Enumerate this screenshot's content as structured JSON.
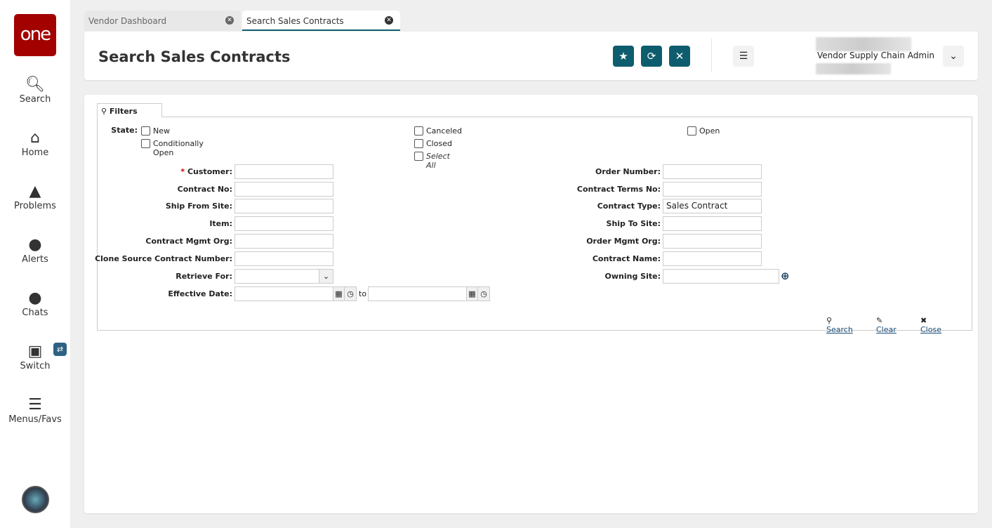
{
  "sidebar": {
    "logo": "one",
    "items": [
      {
        "label": "Search",
        "icon": "search-icon"
      },
      {
        "label": "Home",
        "icon": "home-icon"
      },
      {
        "label": "Problems",
        "icon": "warning-icon"
      },
      {
        "label": "Alerts",
        "icon": "bell-icon"
      },
      {
        "label": "Chats",
        "icon": "chat-icon"
      },
      {
        "label": "Switch",
        "icon": "switch-icon"
      },
      {
        "label": "Menus/Favs",
        "icon": "menu-icon"
      }
    ],
    "switch_badge": "⇄"
  },
  "tabs": [
    {
      "label": "Vendor Dashboard",
      "active": false
    },
    {
      "label": "Search Sales Contracts",
      "active": true
    }
  ],
  "header": {
    "title": "Search Sales Contracts",
    "user_role": "Vendor Supply Chain Admin"
  },
  "filters": {
    "tab_label": "Filters",
    "state_label": "State:",
    "states": [
      {
        "label": "New",
        "checked": false
      },
      {
        "label": "Conditionally Open",
        "checked": false
      },
      {
        "label": "Canceled",
        "checked": false
      },
      {
        "label": "Closed",
        "checked": false
      },
      {
        "label": "Select All",
        "checked": false
      },
      {
        "label": "Open",
        "checked": false
      }
    ],
    "left_fields": [
      {
        "label": "Customer:",
        "required": "*",
        "value": ""
      },
      {
        "label": "Contract No:",
        "value": ""
      },
      {
        "label": "Ship From Site:",
        "value": ""
      },
      {
        "label": "Item:",
        "value": ""
      },
      {
        "label": "Contract Mgmt Org:",
        "value": ""
      },
      {
        "label": "Clone Source Contract Number:",
        "value": ""
      },
      {
        "label": "Retrieve For:",
        "value": ""
      },
      {
        "label": "Effective Date:",
        "value": ""
      }
    ],
    "date_to": "to",
    "right_fields": [
      {
        "label": "Order Number:",
        "value": ""
      },
      {
        "label": "Contract Terms No:",
        "value": ""
      },
      {
        "label": "Contract Type:",
        "value": "Sales Contract"
      },
      {
        "label": "Ship To Site:",
        "value": ""
      },
      {
        "label": "Order Mgmt Org:",
        "value": ""
      },
      {
        "label": "Contract Name:",
        "value": ""
      },
      {
        "label": "Owning Site:",
        "value": ""
      }
    ],
    "actions": {
      "search": "Search",
      "clear": "Clear",
      "close": "Close"
    }
  }
}
